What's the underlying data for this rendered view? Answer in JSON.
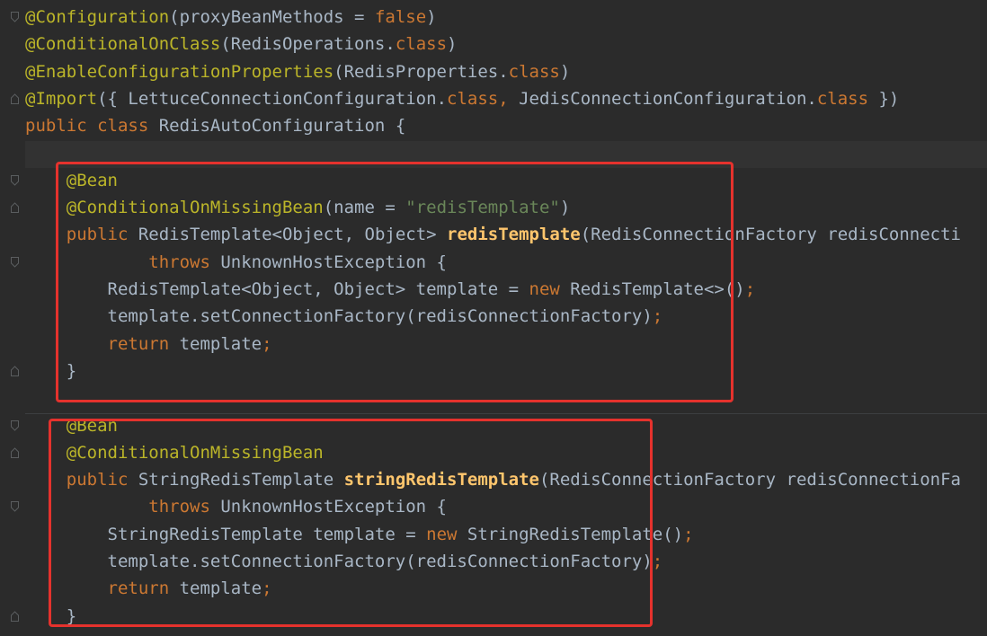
{
  "editor": {
    "lines": [
      [
        {
          "t": "@Configuration",
          "c": "ann"
        },
        {
          "t": "(proxyBeanMethods = ",
          "c": "txt"
        },
        {
          "t": "false",
          "c": "kw"
        },
        {
          "t": ")",
          "c": "txt"
        }
      ],
      [
        {
          "t": "@ConditionalOnClass",
          "c": "ann"
        },
        {
          "t": "(RedisOperations.",
          "c": "txt"
        },
        {
          "t": "class",
          "c": "kw"
        },
        {
          "t": ")",
          "c": "txt"
        }
      ],
      [
        {
          "t": "@EnableConfigurationProperties",
          "c": "ann"
        },
        {
          "t": "(RedisProperties.",
          "c": "txt"
        },
        {
          "t": "class",
          "c": "kw"
        },
        {
          "t": ")",
          "c": "txt"
        }
      ],
      [
        {
          "t": "@Import",
          "c": "ann"
        },
        {
          "t": "({ LettuceConnectionConfiguration.",
          "c": "txt"
        },
        {
          "t": "class",
          "c": "kw"
        },
        {
          "t": ", ",
          "c": "kw"
        },
        {
          "t": "JedisConnectionConfiguration.",
          "c": "txt"
        },
        {
          "t": "class",
          "c": "kw"
        },
        {
          "t": " })",
          "c": "txt"
        }
      ],
      [
        {
          "t": "public class ",
          "c": "kw"
        },
        {
          "t": "RedisAutoConfiguration {",
          "c": "txt"
        }
      ],
      [],
      [
        {
          "t": "    @Bean",
          "c": "ann"
        }
      ],
      [
        {
          "t": "    @ConditionalOnMissingBean",
          "c": "ann"
        },
        {
          "t": "(name = ",
          "c": "txt"
        },
        {
          "t": "\"redisTemplate\"",
          "c": "str"
        },
        {
          "t": ")",
          "c": "txt"
        }
      ],
      [
        {
          "t": "    public ",
          "c": "kw"
        },
        {
          "t": "RedisTemplate<Object, Object> ",
          "c": "txt"
        },
        {
          "t": "redisTemplate",
          "c": "fn"
        },
        {
          "t": "(RedisConnectionFactory redisConnecti",
          "c": "txt"
        }
      ],
      [
        {
          "t": "            throws ",
          "c": "kw"
        },
        {
          "t": "UnknownHostException {",
          "c": "txt"
        }
      ],
      [
        {
          "t": "        RedisTemplate<Object, Object> template = ",
          "c": "txt"
        },
        {
          "t": "new ",
          "c": "kw"
        },
        {
          "t": "RedisTemplate<>()",
          "c": "txt"
        },
        {
          "t": ";",
          "c": "kw"
        }
      ],
      [
        {
          "t": "        template.setConnectionFactory(redisConnectionFactory)",
          "c": "txt"
        },
        {
          "t": ";",
          "c": "kw"
        }
      ],
      [
        {
          "t": "        return ",
          "c": "kw"
        },
        {
          "t": "template",
          "c": "txt"
        },
        {
          "t": ";",
          "c": "kw"
        }
      ],
      [
        {
          "t": "    }",
          "c": "txt"
        }
      ],
      [],
      [
        {
          "t": "    @Bean",
          "c": "ann"
        }
      ],
      [
        {
          "t": "    @ConditionalOnMissingBean",
          "c": "ann"
        }
      ],
      [
        {
          "t": "    public ",
          "c": "kw"
        },
        {
          "t": "StringRedisTemplate ",
          "c": "txt"
        },
        {
          "t": "stringRedisTemplate",
          "c": "fn"
        },
        {
          "t": "(RedisConnectionFactory redisConnectionFa",
          "c": "txt"
        }
      ],
      [
        {
          "t": "            throws ",
          "c": "kw"
        },
        {
          "t": "UnknownHostException {",
          "c": "txt"
        }
      ],
      [
        {
          "t": "        StringRedisTemplate template = ",
          "c": "txt"
        },
        {
          "t": "new ",
          "c": "kw"
        },
        {
          "t": "StringRedisTemplate()",
          "c": "txt"
        },
        {
          "t": ";",
          "c": "kw"
        }
      ],
      [
        {
          "t": "        template.setConnectionFactory(redisConnectionFactory)",
          "c": "txt"
        },
        {
          "t": ";",
          "c": "kw"
        }
      ],
      [
        {
          "t": "        return ",
          "c": "kw"
        },
        {
          "t": "template",
          "c": "txt"
        },
        {
          "t": ";",
          "c": "kw"
        }
      ],
      [
        {
          "t": "    }",
          "c": "txt"
        }
      ]
    ]
  },
  "colors": {
    "background": "#2b2b2b",
    "annotation": "#bbb529",
    "keyword": "#cc7832",
    "string": "#6a8759",
    "method": "#ffc66d",
    "text": "#a9b7c6",
    "highlight_box": "#e5322d"
  },
  "gutter_icons": [
    "fold-start-icon",
    "fold-end-icon"
  ]
}
